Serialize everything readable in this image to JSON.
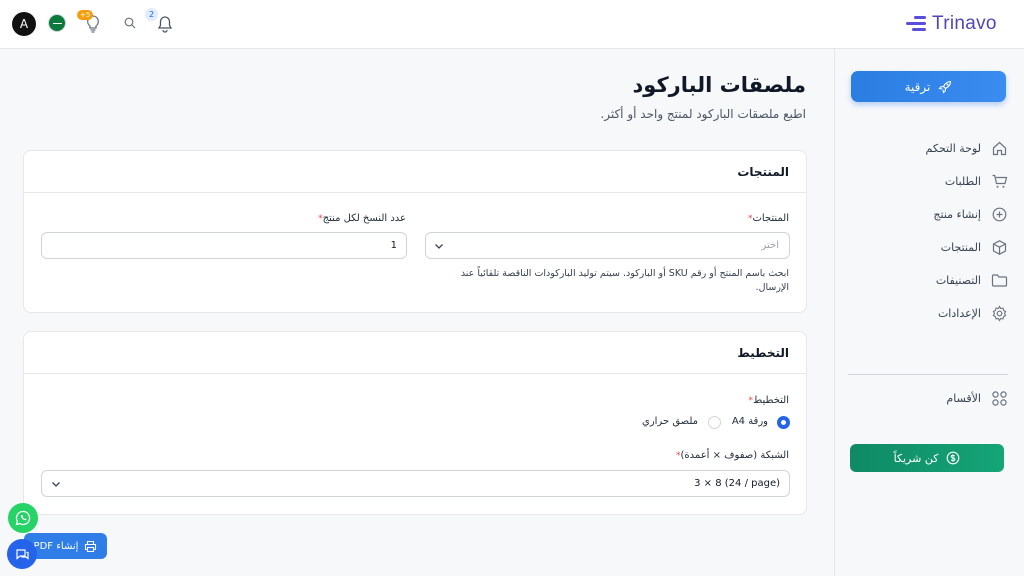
{
  "topbar": {
    "avatar_letter": "A",
    "bulb_badge": "+5",
    "notification_count": "2",
    "logo_text": "Trinavo"
  },
  "sidebar": {
    "upgrade_label": "ترقية",
    "items": [
      {
        "label": "لوحة التحكم",
        "icon": "home-icon"
      },
      {
        "label": "الطلبات",
        "icon": "cart-icon"
      },
      {
        "label": "إنشاء منتج",
        "icon": "plus-circle-icon"
      },
      {
        "label": "المنتجات",
        "icon": "box-icon"
      },
      {
        "label": "التصنيفات",
        "icon": "folder-icon"
      },
      {
        "label": "الإعدادات",
        "icon": "gear-icon"
      }
    ],
    "sections_label": "الأقسام",
    "partner_label": "كن شريكاً"
  },
  "page": {
    "title": "ملصقات الباركود",
    "subtitle": "اطبع ملصقات الباركود لمنتج واحد أو أكثر."
  },
  "products_card": {
    "title": "المنتجات",
    "products_label": "المنتجات",
    "products_placeholder": "اختر",
    "copies_label": "عدد النسخ لكل منتج",
    "copies_value": "1",
    "help_line1": "ابحث باسم المنتج أو رقم SKU أو الباركود. سيتم توليد الباركودات الناقصة تلقائياً عند",
    "help_line2": "الإرسال."
  },
  "layout_card": {
    "title": "التخطيط",
    "layout_label": "التخطيط",
    "option_a4": "ورقة A4",
    "option_thermal": "ملصق حراري",
    "selected": "ورقة A4",
    "grid_label": "الشبكة (صفوف × أعمدة)",
    "grid_value": "3 × 8 (24 / page)"
  },
  "actions": {
    "pdf_label": "إنشاء PDF"
  },
  "colors": {
    "primary": "#2f7de6",
    "partner": "#15a577",
    "brand": "#4f46b8"
  }
}
